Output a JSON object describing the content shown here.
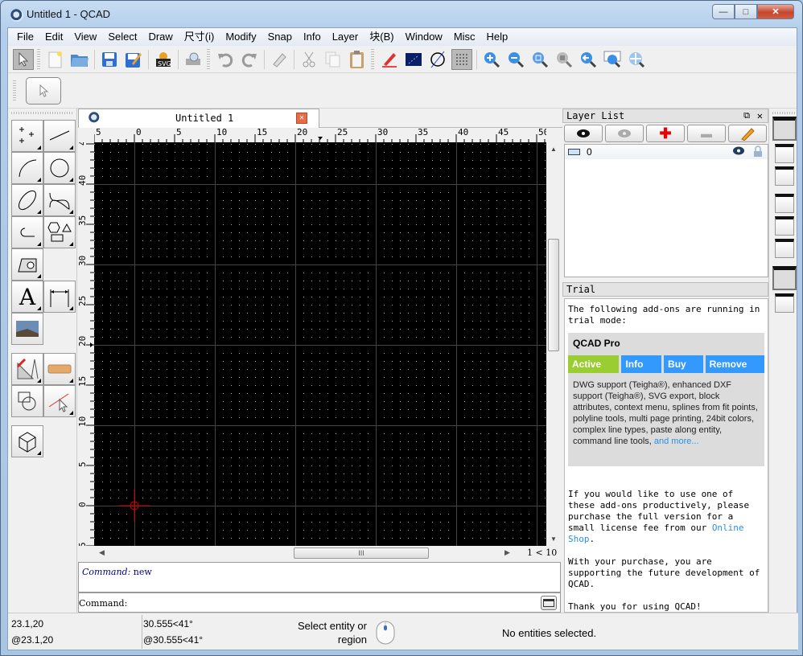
{
  "window": {
    "title": "Untitled 1 - QCAD",
    "min": "—",
    "max": "□",
    "close": "✕"
  },
  "menu": [
    "File",
    "Edit",
    "View",
    "Select",
    "Draw",
    "尺寸(i)",
    "Modify",
    "Snap",
    "Info",
    "Layer",
    "块(B)",
    "Window",
    "Misc",
    "Help"
  ],
  "toolbar": {
    "icons": [
      "pointer-icon",
      "new-file-icon",
      "open-folder-icon",
      "save-icon",
      "save-as-icon",
      "svg-export-icon",
      "print-preview-icon",
      "undo-icon",
      "redo-icon",
      "eraser-icon",
      "cut-icon",
      "copy-icon",
      "paste-icon",
      "pen-icon",
      "drawing-area-icon",
      "no-color-icon",
      "grid-icon",
      "zoom-in-icon",
      "zoom-out-icon",
      "zoom-auto-icon",
      "zoom-selection-icon",
      "zoom-previous-icon",
      "zoom-window-icon",
      "pan-icon"
    ]
  },
  "document": {
    "tab_title": "Untitled 1",
    "close": "✕"
  },
  "ruler": {
    "h_ticks": [
      "5",
      "0",
      "5",
      "10",
      "15",
      "20",
      "25",
      "30",
      "35",
      "40",
      "45",
      "50"
    ],
    "v_ticks": [
      "4",
      "40",
      "35",
      "30",
      "25",
      "20",
      "15",
      "10",
      "5",
      "0",
      "5"
    ]
  },
  "scroll": {
    "page": "1 < 10",
    "grip": "III"
  },
  "command": {
    "log_prefix": "Command:",
    "log_value": "new",
    "prompt": "Command:"
  },
  "layer_panel": {
    "title": "Layer List",
    "layers": [
      {
        "name": "0",
        "visible": true,
        "locked": true
      }
    ]
  },
  "trial_panel": {
    "title": "Trial",
    "intro": "The following add-ons are running in trial mode:",
    "addon": {
      "name": "QCAD Pro",
      "buttons": [
        {
          "label": "Active",
          "color": "#9acd32"
        },
        {
          "label": "Info",
          "color": "#3399ff"
        },
        {
          "label": "Buy",
          "color": "#3399ff"
        },
        {
          "label": "Remove",
          "color": "#3399ff"
        }
      ],
      "description": "DWG support (Teigha®), enhanced DXF support (Teigha®), SVG export, block attributes, context menu, splines from fit points, polyline tools, multi page printing, 24bit colors, complex line types, paste along entity, command line tools,",
      "more_link": "and more..."
    },
    "para1_start": "If you would like to use one of these add-ons productively, please purchase the full version for a small license fee from our",
    "shop_link": "Online Shop",
    "para1_end": ".",
    "para2": "With your purchase, you are supporting the future development of QCAD.",
    "para3": "Thank you for using QCAD!"
  },
  "status": {
    "abs": "23.1,20",
    "rel": "@23.1,20",
    "polar": "30.555<41°",
    "rel_polar": "@30.555<41°",
    "hint": "Select entity or region",
    "selection": "No entities selected."
  }
}
